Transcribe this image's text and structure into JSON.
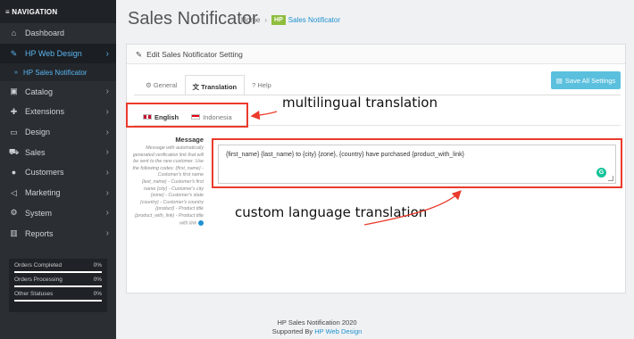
{
  "sidebar": {
    "header": "≡ NAVIGATION",
    "items": [
      {
        "icon": "⌂",
        "label": "Dashboard"
      },
      {
        "icon": "✎",
        "label": "HP Web Design",
        "chevron": "›"
      },
      {
        "icon": "»",
        "label": "HP Sales Notificator"
      },
      {
        "icon": "▣",
        "label": "Catalog",
        "chevron": "›"
      },
      {
        "icon": "✚",
        "label": "Extensions",
        "chevron": "›"
      },
      {
        "icon": "▭",
        "label": "Design",
        "chevron": "›"
      },
      {
        "icon": "⛟",
        "label": "Sales",
        "chevron": "›"
      },
      {
        "icon": "●",
        "label": "Customers",
        "chevron": "›"
      },
      {
        "icon": "◁",
        "label": "Marketing",
        "chevron": "›"
      },
      {
        "icon": "⚙",
        "label": "System",
        "chevron": "›"
      },
      {
        "icon": "▥",
        "label": "Reports",
        "chevron": "›"
      }
    ],
    "stats": [
      {
        "label": "Orders Completed",
        "value": "0%",
        "progress": 0
      },
      {
        "label": "Orders Processing",
        "value": "0%",
        "progress": 0
      },
      {
        "label": "Other Statuses",
        "value": "0%",
        "progress": 0
      }
    ]
  },
  "header": {
    "title": "Sales Notificator",
    "breadcrumb_home": "Home",
    "breadcrumb_sep": "›",
    "breadcrumb_badge": "HP",
    "breadcrumb_current": "Sales Notificator"
  },
  "panel": {
    "heading": "Edit Sales Notificator Setting",
    "tabs": [
      {
        "icon": "⚙",
        "label": "General"
      },
      {
        "icon": "文",
        "label": "Translation"
      },
      {
        "icon": "?",
        "label": "Help"
      }
    ],
    "save_button": "Save All Settings",
    "languages": [
      "English",
      "Indonesia"
    ],
    "message_label": "Message",
    "message_help": "Message with automatically generated verification link that will be sent to the new customer. Use the following codes: {first_name} - Customer's first name {last_name} - Customer's first name {city} - Customer's city {zone} - Customer's state {country} - Customer's country {product} - Product title {product_with_link} - Product title with link",
    "message_value": "{first_name} {last_name}   to   {city} {zone}, {country} have purchased {product_with_link}"
  },
  "annotations": {
    "top": "multilingual translation",
    "bottom": "custom language translation"
  },
  "footer": {
    "line1": "HP Sales Notification 2020",
    "line2_prefix": "Supported By ",
    "line2_link": "HP Web Design"
  },
  "colors": {
    "accent": "#1e91cf",
    "highlight": "#ea3b2c",
    "save_button": "#5bc0de",
    "sidebar": "#2b2f33"
  }
}
